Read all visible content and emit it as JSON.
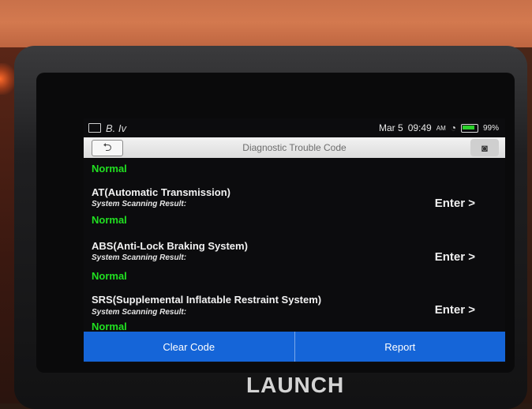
{
  "status_bar": {
    "app_badge": "B. Iv",
    "date": "Mar 5",
    "time": "09:49",
    "ampm": "AM",
    "battery": "99%"
  },
  "header": {
    "title": "Diagnostic Trouble Code",
    "back_icon": "back-arrow-icon",
    "camera_icon": "camera-icon"
  },
  "top_status": "Normal",
  "systems": [
    {
      "name": "AT(Automatic Transmission)",
      "label": "System Scanning Result:",
      "status": "Normal",
      "action": "Enter >"
    },
    {
      "name": "ABS(Anti-Lock Braking System)",
      "label": "System Scanning Result:",
      "status": "Normal",
      "action": "Enter >"
    },
    {
      "name": "SRS(Supplemental Inflatable Restraint System)",
      "label": "System Scanning Result:",
      "status": "Normal",
      "action": "Enter >"
    }
  ],
  "footer": {
    "clear_label": "Clear Code",
    "report_label": "Report"
  },
  "device": {
    "brand": "LAUNCH"
  },
  "colors": {
    "accent": "#1565d8",
    "normal": "#21e021"
  }
}
